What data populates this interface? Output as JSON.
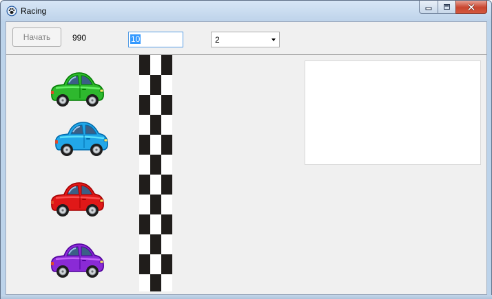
{
  "window": {
    "title": "Racing",
    "icon": "paw-icon"
  },
  "toolbar": {
    "start_label": "Начать",
    "counter_value": "990",
    "distance_value": "10",
    "car_count_value": "2"
  },
  "track": {
    "cars": [
      {
        "name": "green-car",
        "color": "#2eb82e"
      },
      {
        "name": "blue-car",
        "color": "#22a7e8"
      },
      {
        "name": "red-car",
        "color": "#e01818"
      },
      {
        "name": "purple-car",
        "color": "#8a2ad6"
      }
    ],
    "finish_colors": [
      "#201d1b",
      "#ffffff"
    ]
  },
  "log": {
    "text": ""
  }
}
